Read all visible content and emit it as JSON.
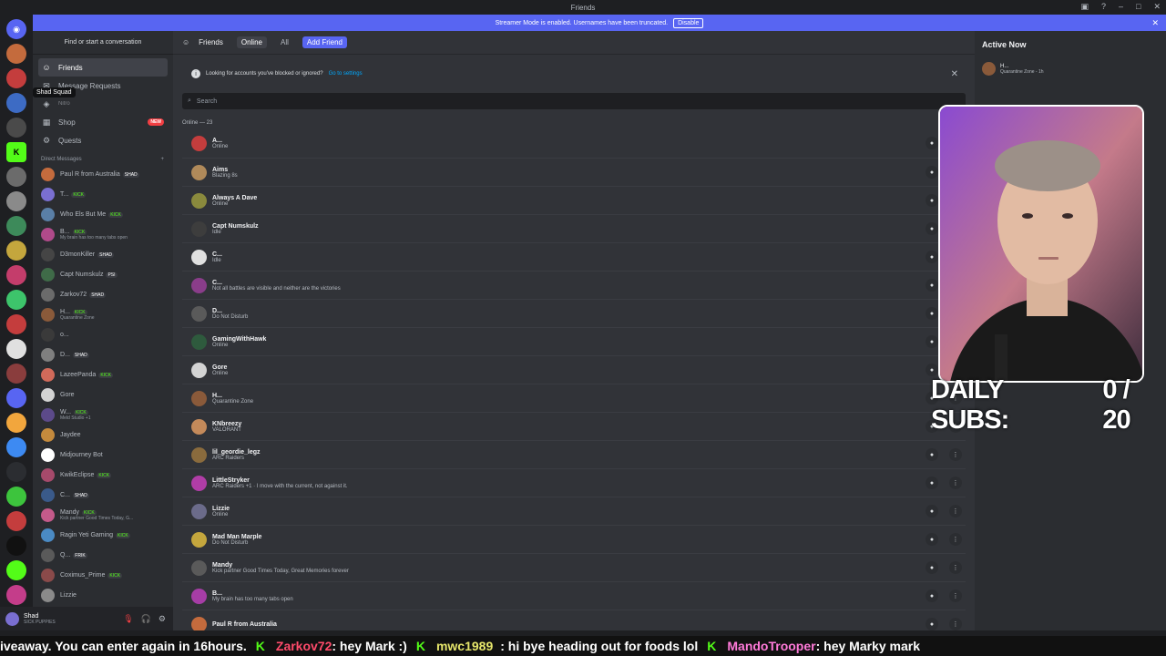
{
  "window": {
    "title": "Friends"
  },
  "banner": {
    "text": "Streamer Mode is enabled. Usernames have been truncated.",
    "button": "Disable"
  },
  "sidebar": {
    "search_button": "Find or start a conversation",
    "nav": [
      {
        "label": "Friends",
        "icon": "friends-icon"
      },
      {
        "label": "Message Requests",
        "icon": "envelope-icon"
      },
      {
        "label": "Nitro",
        "icon": "nitro-icon"
      },
      {
        "label": "Shop",
        "icon": "shop-icon",
        "badge": "NEW"
      },
      {
        "label": "Quests",
        "icon": "quests-icon"
      }
    ],
    "tooltip": "Shad Squad",
    "dm_header": "Direct Messages",
    "dms": [
      {
        "name": "Paul R from Australia",
        "tag": "SHAD",
        "color": "#c46b3d"
      },
      {
        "name": "T...",
        "tag": "KICK",
        "color": "#7a6fd1"
      },
      {
        "name": "Who Els But Me",
        "tag": "KICK",
        "color": "#5a7fa6"
      },
      {
        "name": "B...",
        "tag": "KICK",
        "status": "My brain has too many tabs open",
        "color": "#b04a8a"
      },
      {
        "name": "D3monKiller",
        "tag": "SHAD",
        "color": "#454545"
      },
      {
        "name": "Capt Numskulz",
        "tag": "PSI",
        "color": "#3f6b48"
      },
      {
        "name": "Zarkov72",
        "tag": "SHAD",
        "color": "#6b6b6b"
      },
      {
        "name": "H...",
        "tag": "KICK",
        "status": "Quarantine Zone",
        "color": "#8a5a3a"
      },
      {
        "name": "o...",
        "tag": "",
        "color": "#3a3a3a"
      },
      {
        "name": "D...",
        "tag": "SHAD",
        "color": "#7f7f7f"
      },
      {
        "name": "LazeePanda",
        "tag": "KICK",
        "color": "#d16a5a"
      },
      {
        "name": "Gore",
        "tag": "",
        "color": "#d3d3d3"
      },
      {
        "name": "W...",
        "tag": "KICK",
        "status": "Meld Studio +1",
        "color": "#5c4a8a"
      },
      {
        "name": "Jaydee",
        "tag": "",
        "color": "#c48a3d"
      },
      {
        "name": "Midjourney Bot",
        "tag": "",
        "color": "#ffffff"
      },
      {
        "name": "KwikEclipse",
        "tag": "KICK",
        "color": "#a64a6b"
      },
      {
        "name": "C...",
        "tag": "SHAD",
        "color": "#3a5a8a"
      },
      {
        "name": "Mandy",
        "tag": "KICK",
        "status": "Kick partner Good Times Today, G...",
        "color": "#c45a8a"
      },
      {
        "name": "Ragin Yeti Gaming",
        "tag": "KICK",
        "color": "#4a8ac4"
      },
      {
        "name": "Q...",
        "tag": "FRIK",
        "color": "#5a5a5a"
      },
      {
        "name": "Coximus_Prime",
        "tag": "KICK",
        "color": "#8a4a4a"
      },
      {
        "name": "Lizzie",
        "tag": "",
        "color": "#8a8a8a"
      }
    ]
  },
  "user_panel": {
    "name": "Shad",
    "status": "SICK PUPPIES"
  },
  "main": {
    "tabs": [
      {
        "label": "Friends"
      },
      {
        "label": "Online"
      },
      {
        "label": "All"
      },
      {
        "label": "Add Friend"
      }
    ],
    "notice": {
      "text": "Looking for accounts you've blocked or ignored?",
      "link": "Go to settings"
    },
    "search_placeholder": "Search",
    "online_count": "Online — 23",
    "friends": [
      {
        "name": "A...",
        "status": "Online",
        "color": "#c43d3d"
      },
      {
        "name": "Aims",
        "status": "Blazing 8s",
        "color": "#b08a5a"
      },
      {
        "name": "Always A Dave",
        "status": "Online",
        "color": "#8a8a3d"
      },
      {
        "name": "Capt Numskulz",
        "status": "Idle",
        "color": "#3d3d3d"
      },
      {
        "name": "C...",
        "status": "Idle",
        "color": "#e0e0e0"
      },
      {
        "name": "C...",
        "status": "Not all battles are visible and neither are the victories",
        "color": "#8a3d8a"
      },
      {
        "name": "D...",
        "status": "Do Not Disturb",
        "color": "#5a5a5a"
      },
      {
        "name": "GamingWithHawk",
        "status": "Online",
        "color": "#2e5a3d"
      },
      {
        "name": "Gore",
        "status": "Online",
        "color": "#d3d3d3"
      },
      {
        "name": "H...",
        "status": "Quarantine Zone",
        "color": "#8a5a3a"
      },
      {
        "name": "KNbreezy",
        "status": "VALORANT",
        "color": "#c48a5a"
      },
      {
        "name": "lil_geordie_legz",
        "status": "ARC Raiders",
        "color": "#8a6b3d"
      },
      {
        "name": "LittleStryker",
        "status": "ARC Raiders +1 · I move with the current, not against it.",
        "color": "#b03da6"
      },
      {
        "name": "Lizzie",
        "status": "Online",
        "color": "#6b6b8a"
      },
      {
        "name": "Mad Man Marple",
        "status": "Do Not Disturb",
        "color": "#c4a63d"
      },
      {
        "name": "Mandy",
        "status": "Kick partner Good Times Today, Great Memories forever",
        "color": "#5a5a5a"
      },
      {
        "name": "B...",
        "status": "My brain has too many tabs open",
        "color": "#a63da6"
      },
      {
        "name": "Paul R from Australia",
        "status": "",
        "color": "#c46b3d"
      }
    ]
  },
  "active_now": {
    "header": "Active Now",
    "name": "H...",
    "status": "Quarantine Zone - 1h"
  },
  "overlay": {
    "subs_label": "DAILY SUBS:",
    "subs_value": "0 / 20"
  },
  "ticker": [
    {
      "user": "",
      "text": "iveaway. You can enter again in 16hours."
    },
    {
      "user": "Zarkov72",
      "text": ": hey Mark :)"
    },
    {
      "user": "mwc1989",
      "text": ": hi bye heading out for foods lol"
    },
    {
      "user": "MandoTrooper",
      "text": ": hey Marky mark"
    }
  ],
  "colors": {
    "accent": "#5865f2",
    "kick": "#53fc18",
    "bg": "#313338",
    "sidebar": "#2b2d31",
    "user_red": "#ff4b6b",
    "user_pink": "#ff7ad9"
  }
}
